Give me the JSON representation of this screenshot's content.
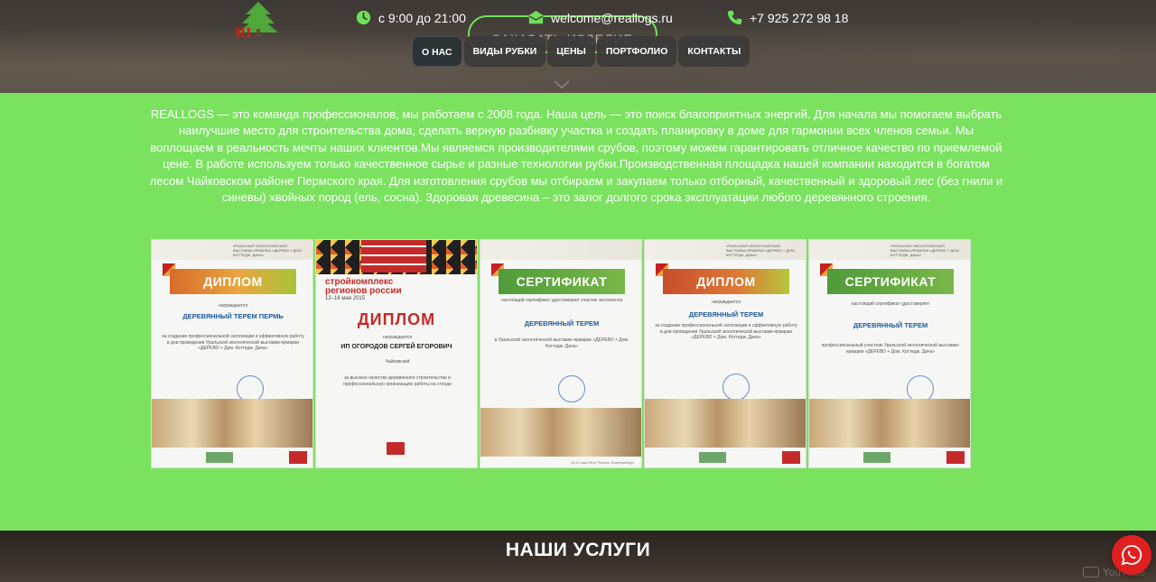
{
  "header": {
    "logo_text": "RL",
    "hours": "с 9:00 до 21:00",
    "email": "welcome@reallogs.ru",
    "phone": "+7 925 272 98 18",
    "order_button": "ЗАКАЗАТЬ ИЗДЕЛИЕ",
    "icons": {
      "hours": "clock-icon",
      "email": "envelope-icon",
      "phone": "phone-icon"
    },
    "accent_color": "#6ee05a"
  },
  "nav": {
    "items": [
      {
        "label": "О НАС",
        "active": true
      },
      {
        "label": "ВИДЫ РУБКИ",
        "active": false
      },
      {
        "label": "ЦЕНЫ",
        "active": false
      },
      {
        "label": "ПОРТФОЛИО",
        "active": false
      },
      {
        "label": "КОНТАКТЫ",
        "active": false
      }
    ]
  },
  "about": {
    "background_color": "#7ae25f",
    "text": "REALLOGS — это команда профессионалов, мы работаем с 2008 года. Наша цель — это поиск благоприятных энергий. Для начала мы помогаем выбрать наилучшие место для строительства дома, сделать верную разбивку участка и создать планировку в доме для гармонии всех членов семьи. Мы воплощаем в реальность мечты наших клиентов.Мы являемся производителями срубов, поэтому можем гарантировать отличное качество по приемлемой цене. В работе используем только качественное сырье и разные технологии рубки.Производственная площадка нашей компании находится в богатом лесом Чайковском районе Пермского края. Для изготовления срубов мы отбираем и закупаем только отборный, качественный и здоровый лес (без гнили и синевы) хвойных пород (ель, сосна). Здоровая древесина – это залог долгого срока эксплуатации любого деревянного строения."
  },
  "certificates": [
    {
      "banner": "ДИПЛОМ",
      "header": "УРАЛЬСКАЯ ЭКОЛОГИЧЕСКАЯ ВЫСТАВКА-ЯРМАРКА «ДЕРЕВО + ДОМ. КОТТЕДЖ. ДАЧА»",
      "awarded": "награждается",
      "title": "ДЕРЕВЯННЫЙ ТЕРЕМ ПЕРМЬ",
      "body": "за создание профессиональной экспозиции и эффективную работу в дни проведения Уральской экологической выставки-ярмарки «ДЕРЕВО + Дом. Коттедж. Дача»"
    },
    {
      "header": "стройкомплекс регионов россии",
      "date": "12–16 мая 2015",
      "banner": "ДИПЛОМ",
      "awarded": "награждается",
      "title": "ИП ОГОРОДОВ СЕРГЕЙ ЕГОРОВИЧ",
      "city": "Чайковский",
      "body": "за высокое качество деревянного строительства и профессиональную организацию работы на стенде"
    },
    {
      "banner": "СЕРТИФИКАТ",
      "awarded": "настоящий сертификат удостоверяет участие экспонента",
      "title": "ДЕРЕВЯННЫЙ ТЕРЕМ",
      "body": "в Уральской экологической выставке-ярмарке «ДЕРЕВО + Дом. Коттедж. Дача»",
      "date": "15-17 мая 2014 Россия, Екатеринбург"
    },
    {
      "header": "УРАЛЬСКАЯ ЭКОЛОГИЧЕСКАЯ ВЫСТАВКА-ЯРМАРКА «ДЕРЕВО + ДОМ. КОТТЕДЖ. ДАЧА»",
      "banner": "ДИПЛОМ",
      "awarded": "награждается",
      "title": "ДЕРЕВЯННЫЙ ТЕРЕМ",
      "body": "за создание профессиональной экспозиции и эффективную работу в дни проведения Уральской экологической выставки-ярмарки «ДЕРЕВО + Дом. Коттедж. Дача»"
    },
    {
      "header": "УРАЛЬСКАЯ ЭКОЛОГИЧЕСКАЯ ВЫСТАВКА-ЯРМАРКА «ДЕРЕВО + ДОМ. КОТТЕДЖ. ДАЧА»",
      "banner": "СЕРТИФИКАТ",
      "awarded": "настоящий сертификат удостоверяет",
      "title": "ДЕРЕВЯННЫЙ ТЕРЕМ",
      "body": "профессиональный участник Уральской экологической выставки-ярмарки «ДЕРЕВО + Дом. Коттедж. Дача»"
    }
  ],
  "services": {
    "title": "НАШИ УСЛУГИ",
    "watermark": "YouTube"
  },
  "whatsapp": {
    "icon": "whatsapp-icon",
    "color": "#e02020"
  }
}
